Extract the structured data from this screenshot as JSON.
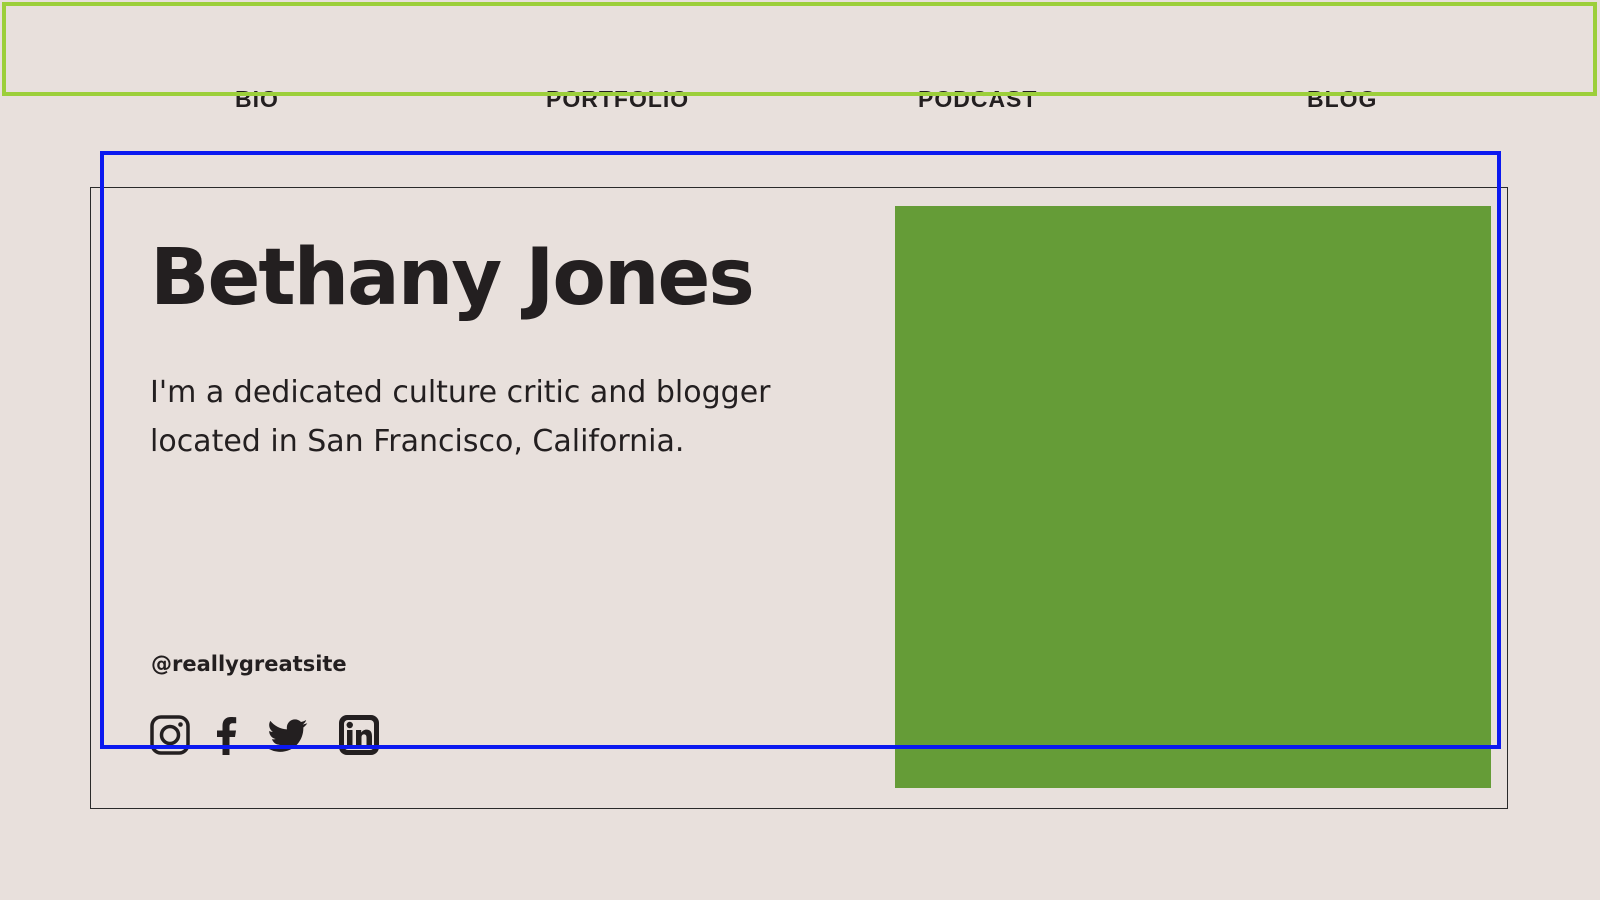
{
  "nav": {
    "items": [
      {
        "label": "BIO"
      },
      {
        "label": "PORTFOLIO"
      },
      {
        "label": "PODCAST"
      },
      {
        "label": "BLOG"
      }
    ]
  },
  "profile": {
    "name": "Bethany Jones",
    "tagline": "I'm a dedicated culture critic and blogger located in San Francisco, California.",
    "handle": "@reallygreatsite"
  },
  "socials": [
    {
      "icon": "instagram-icon"
    },
    {
      "icon": "facebook-icon"
    },
    {
      "icon": "twitter-icon"
    },
    {
      "icon": "linkedin-icon"
    }
  ],
  "colors": {
    "background": "#e8e0dc",
    "text": "#231f20",
    "photo_placeholder": "#659c37",
    "top_highlight": "#9ccf3a",
    "selection_highlight": "#0b19f0"
  }
}
